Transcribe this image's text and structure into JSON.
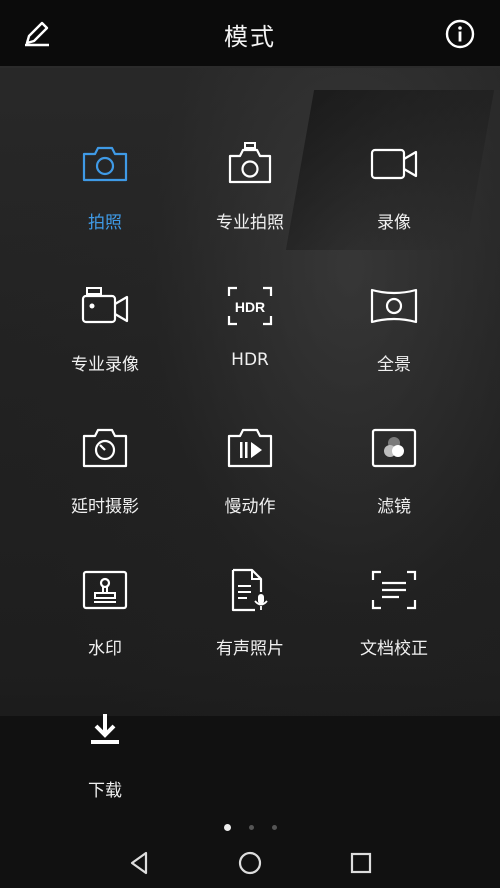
{
  "header": {
    "title": "模式"
  },
  "modes": [
    {
      "label": "拍照",
      "icon": "camera-icon",
      "active": true
    },
    {
      "label": "专业拍照",
      "icon": "pro-camera-icon",
      "active": false
    },
    {
      "label": "录像",
      "icon": "video-icon",
      "active": false
    },
    {
      "label": "专业录像",
      "icon": "pro-video-icon",
      "active": false
    },
    {
      "label": "HDR",
      "icon": "hdr-icon",
      "active": false
    },
    {
      "label": "全景",
      "icon": "panorama-icon",
      "active": false
    },
    {
      "label": "延时摄影",
      "icon": "time-lapse-icon",
      "active": false
    },
    {
      "label": "慢动作",
      "icon": "slow-motion-icon",
      "active": false
    },
    {
      "label": "滤镜",
      "icon": "filter-icon",
      "active": false
    },
    {
      "label": "水印",
      "icon": "watermark-icon",
      "active": false
    },
    {
      "label": "有声照片",
      "icon": "audio-photo-icon",
      "active": false
    },
    {
      "label": "文档校正",
      "icon": "document-scan-icon",
      "active": false
    },
    {
      "label": "下载",
      "icon": "download-icon",
      "active": false
    }
  ],
  "pager": {
    "pages": 3,
    "current": 1
  },
  "colors": {
    "accent": "#3f9ae6",
    "icon": "#ffffff",
    "topbar": "#0b0b0b"
  }
}
